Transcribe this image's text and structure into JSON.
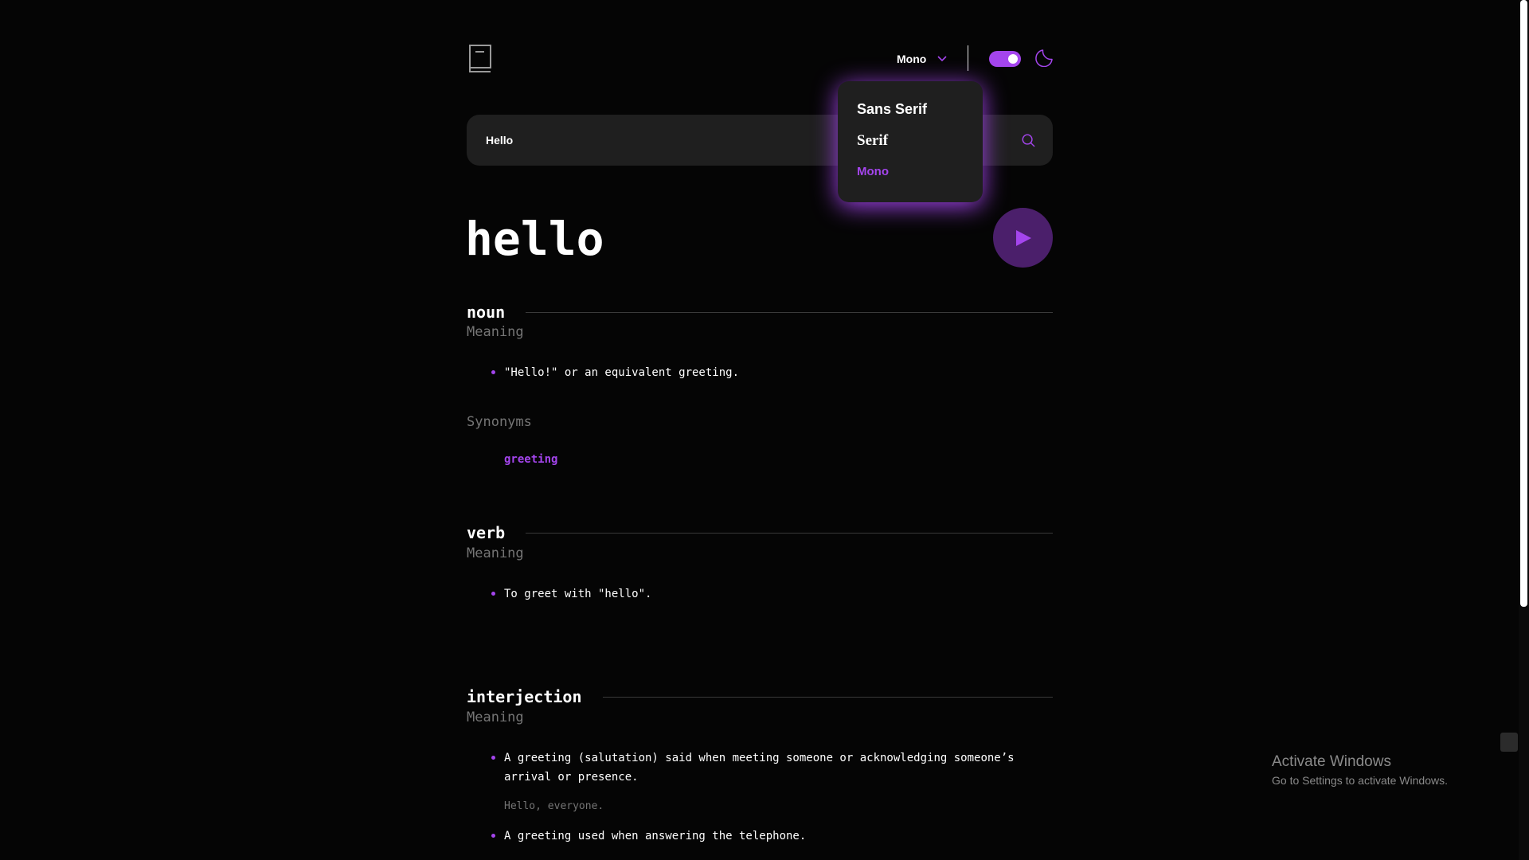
{
  "header": {
    "font_selected": "Mono",
    "theme_toggle_on": true
  },
  "search": {
    "value": "Hello"
  },
  "dropdown": {
    "options": [
      "Sans Serif",
      "Serif",
      "Mono"
    ],
    "selected": "Mono"
  },
  "word": "hello",
  "sections": {
    "noun": {
      "label": "noun",
      "meaning_label": "Meaning",
      "definitions": [
        "\"Hello!\" or an equivalent greeting."
      ],
      "synonyms_label": "Synonyms",
      "synonyms": [
        "greeting"
      ]
    },
    "verb": {
      "label": "verb",
      "meaning_label": "Meaning",
      "definitions": [
        "To greet with \"hello\"."
      ]
    },
    "interjection": {
      "label": "interjection",
      "meaning_label": "Meaning",
      "definitions": [
        "A greeting (salutation) said when meeting someone or acknowledging someone’s arrival or presence.",
        "A greeting used when answering the telephone."
      ],
      "example": "Hello, everyone."
    }
  },
  "watermark": {
    "title": "Activate Windows",
    "subtitle": "Go to Settings to activate Windows."
  },
  "colors": {
    "accent": "#a445ed",
    "background": "#050505",
    "surface": "#1f1f1f",
    "muted": "#757575"
  }
}
